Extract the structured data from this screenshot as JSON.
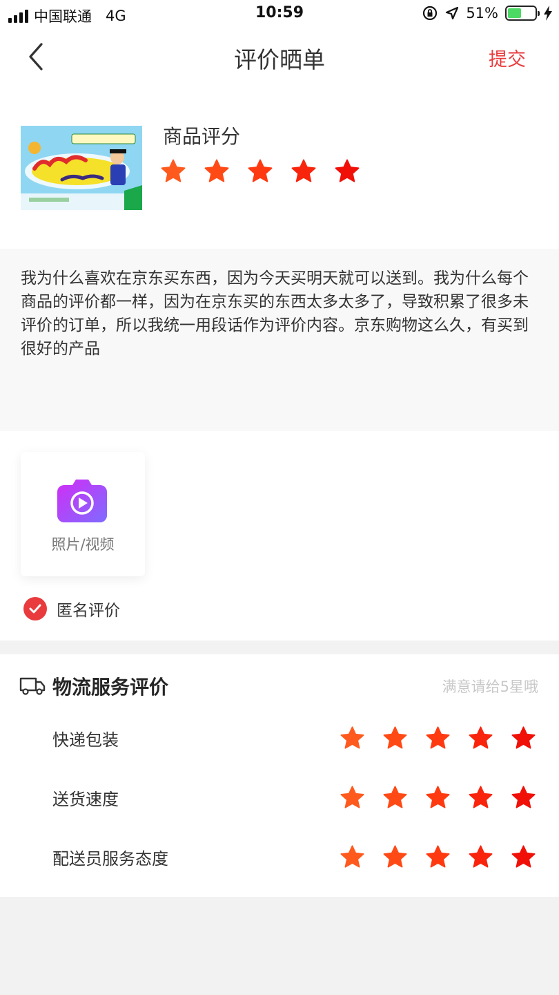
{
  "status_bar": {
    "carrier": "中国联通",
    "network": "4G",
    "time": "10:59",
    "battery": "51%",
    "battery_level": 0.51
  },
  "nav": {
    "title": "评价晒单",
    "submit_label": "提交"
  },
  "product": {
    "rating_label": "商品评分",
    "rating": 5
  },
  "review": {
    "text": "我为什么喜欢在京东买东西，因为今天买明天就可以送到。我为什么每个商品的评价都一样，因为在京东买的东西太多太多了，导致积累了很多未评价的订单，所以我统一用段话作为评价内容。京东购物这么久，有买到很好的产品"
  },
  "media": {
    "upload_label": "照片/视频",
    "anonymous_label": "匿名评价",
    "anonymous_checked": true
  },
  "logistics": {
    "title": "物流服务评价",
    "hint": "满意请给5星哦",
    "items": [
      {
        "label": "快递包装",
        "rating": 5
      },
      {
        "label": "送货速度",
        "rating": 5
      },
      {
        "label": "配送员服务态度",
        "rating": 5
      }
    ]
  },
  "colors": {
    "accent": "#e93b3d",
    "star_colors": [
      "#ff5a1e",
      "#ff4a16",
      "#ff3a10",
      "#f8250c",
      "#f01008"
    ]
  }
}
